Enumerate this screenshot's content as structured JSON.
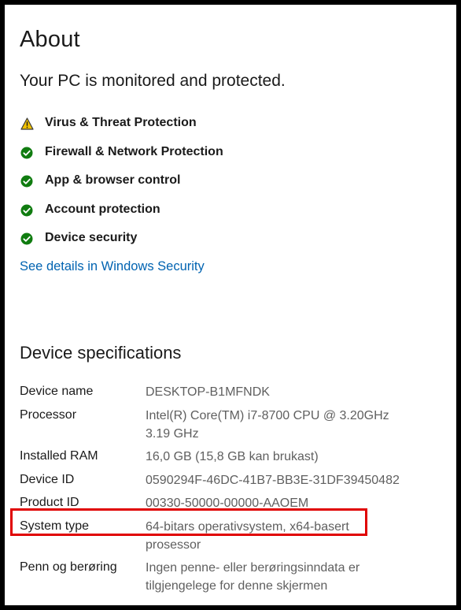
{
  "title": "About",
  "status_message": "Your PC is monitored and protected.",
  "protection_items": [
    {
      "label": "Virus & Threat Protection",
      "status": "warning",
      "icon": "warning-icon"
    },
    {
      "label": "Firewall & Network Protection",
      "status": "ok",
      "icon": "check-circle-icon"
    },
    {
      "label": "App & browser control",
      "status": "ok",
      "icon": "check-circle-icon"
    },
    {
      "label": "Account protection",
      "status": "ok",
      "icon": "check-circle-icon"
    },
    {
      "label": "Device security",
      "status": "ok",
      "icon": "check-circle-icon"
    }
  ],
  "security_link": "See details in Windows Security",
  "device_specs": {
    "heading": "Device specifications",
    "rows": [
      {
        "label": "Device name",
        "value_lines": [
          "DESKTOP-B1MFNDK"
        ]
      },
      {
        "label": "Processor",
        "value_lines": [
          "Intel(R) Core(TM) i7-8700 CPU @ 3.20GHz",
          "3.19 GHz"
        ]
      },
      {
        "label": "Installed RAM",
        "value_lines": [
          "16,0 GB (15,8 GB kan brukast)"
        ]
      },
      {
        "label": "Device ID",
        "value_lines": [
          "0590294F-46DC-41B7-BB3E-31DF39450482"
        ]
      },
      {
        "label": "Product ID",
        "value_lines": [
          "00330-50000-00000-AAOEM"
        ]
      },
      {
        "label": "System type",
        "value_lines": [
          "64-bitars operativsystem, x64-basert",
          "prosessor"
        ]
      },
      {
        "label": "Penn og berøring",
        "value_lines": [
          "Ingen penne- eller berøringsinndata er",
          "tilgjengelege for denne skjermen"
        ]
      }
    ]
  },
  "colors": {
    "accent_link": "#0063b1",
    "ok_green": "#107c10",
    "warning_yellow": "#f2c200",
    "highlight_red": "#e00000"
  }
}
